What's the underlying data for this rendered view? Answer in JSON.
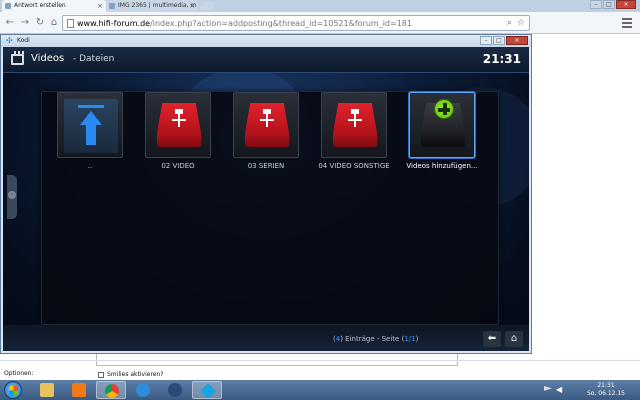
{
  "browser": {
    "tabs": [
      {
        "label": "Antwort erstellen",
        "active": true
      },
      {
        "label": "IMG 2365 | multimedia, m",
        "active": false
      }
    ],
    "url_host": "www.hifi-forum.de",
    "url_rest": "/index.php?action=addposting&thread_id=10521&forum_id=181"
  },
  "page": {
    "optionen_label": "Optionen:",
    "smilies_label": "Smilies aktivieren?"
  },
  "kodi": {
    "window_title": "Kodi",
    "section": "Videos",
    "subsection": "- Dateien",
    "clock": "21:31",
    "items": [
      {
        "label": "..",
        "type": "parent-folder"
      },
      {
        "label": "02 VIDEO",
        "type": "network-source"
      },
      {
        "label": "03 SERIEN",
        "type": "network-source"
      },
      {
        "label": "04 VIDEO SONSTIGE",
        "type": "network-source"
      },
      {
        "label": "Videos hinzufügen...",
        "type": "add-source",
        "focused": true
      }
    ],
    "footer": {
      "count_open": "(",
      "count": "4",
      "count_mid": ") Einträge - Seite (",
      "page": "1/1",
      "count_close": ")"
    }
  },
  "taskbar": {
    "time": "21:31",
    "date": "So, 06.12.15"
  },
  "colors": {
    "kodi_accent": "#3b8ff2",
    "drive_red": "#d41b24",
    "add_green": "#8be024"
  }
}
